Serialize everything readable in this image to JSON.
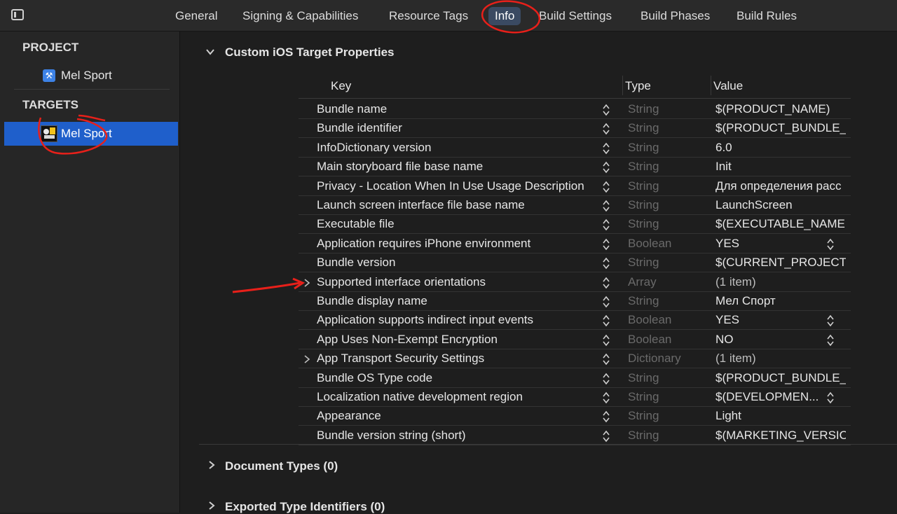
{
  "tabs": [
    "General",
    "Signing & Capabilities",
    "Resource Tags",
    "Info",
    "Build Settings",
    "Build Phases",
    "Build Rules"
  ],
  "active_tab": "Info",
  "sidebar": {
    "project_heading": "PROJECT",
    "project_item": "Mel Sport",
    "targets_heading": "TARGETS",
    "target_item": "Mel Sport"
  },
  "main": {
    "section_title": "Custom iOS Target Properties",
    "columns": {
      "key": "Key",
      "type": "Type",
      "value": "Value"
    },
    "rows": [
      {
        "key": "Bundle name",
        "type": "String",
        "value": "$(PRODUCT_NAME)"
      },
      {
        "key": "Bundle identifier",
        "type": "String",
        "value": "$(PRODUCT_BUNDLE_"
      },
      {
        "key": "InfoDictionary version",
        "type": "String",
        "value": "6.0"
      },
      {
        "key": "Main storyboard file base name",
        "type": "String",
        "value": "Init"
      },
      {
        "key": "Privacy - Location When In Use Usage Description",
        "type": "String",
        "value": "Для определения расс"
      },
      {
        "key": "Launch screen interface file base name",
        "type": "String",
        "value": "LaunchScreen"
      },
      {
        "key": "Executable file",
        "type": "String",
        "value": "$(EXECUTABLE_NAME"
      },
      {
        "key": "Application requires iPhone environment",
        "type": "Boolean",
        "value": "YES"
      },
      {
        "key": "Bundle version",
        "type": "String",
        "value": "$(CURRENT_PROJECT"
      },
      {
        "key": "Supported interface orientations",
        "type": "Array",
        "value": "(1 item)"
      },
      {
        "key": "Bundle display name",
        "type": "String",
        "value": "Мел Спорт"
      },
      {
        "key": "Application supports indirect input events",
        "type": "Boolean",
        "value": "YES"
      },
      {
        "key": "App Uses Non-Exempt Encryption",
        "type": "Boolean",
        "value": "NO"
      },
      {
        "key": "App Transport Security Settings",
        "type": "Dictionary",
        "value": "(1 item)"
      },
      {
        "key": "Bundle OS Type code",
        "type": "String",
        "value": "$(PRODUCT_BUNDLE_"
      },
      {
        "key": "Localization native development region",
        "type": "String",
        "value": "$(DEVELOPMEN..."
      },
      {
        "key": "Appearance",
        "type": "String",
        "value": "Light"
      },
      {
        "key": "Bundle version string (short)",
        "type": "String",
        "value": "$(MARKETING_VERSIO"
      }
    ],
    "document_types": "Document Types (0)",
    "exported_types": "Exported Type Identifiers (0)"
  },
  "colors": {
    "accent": "#1f5fcb",
    "active_tab": "#3a4a62",
    "annotation": "#e8201a"
  }
}
